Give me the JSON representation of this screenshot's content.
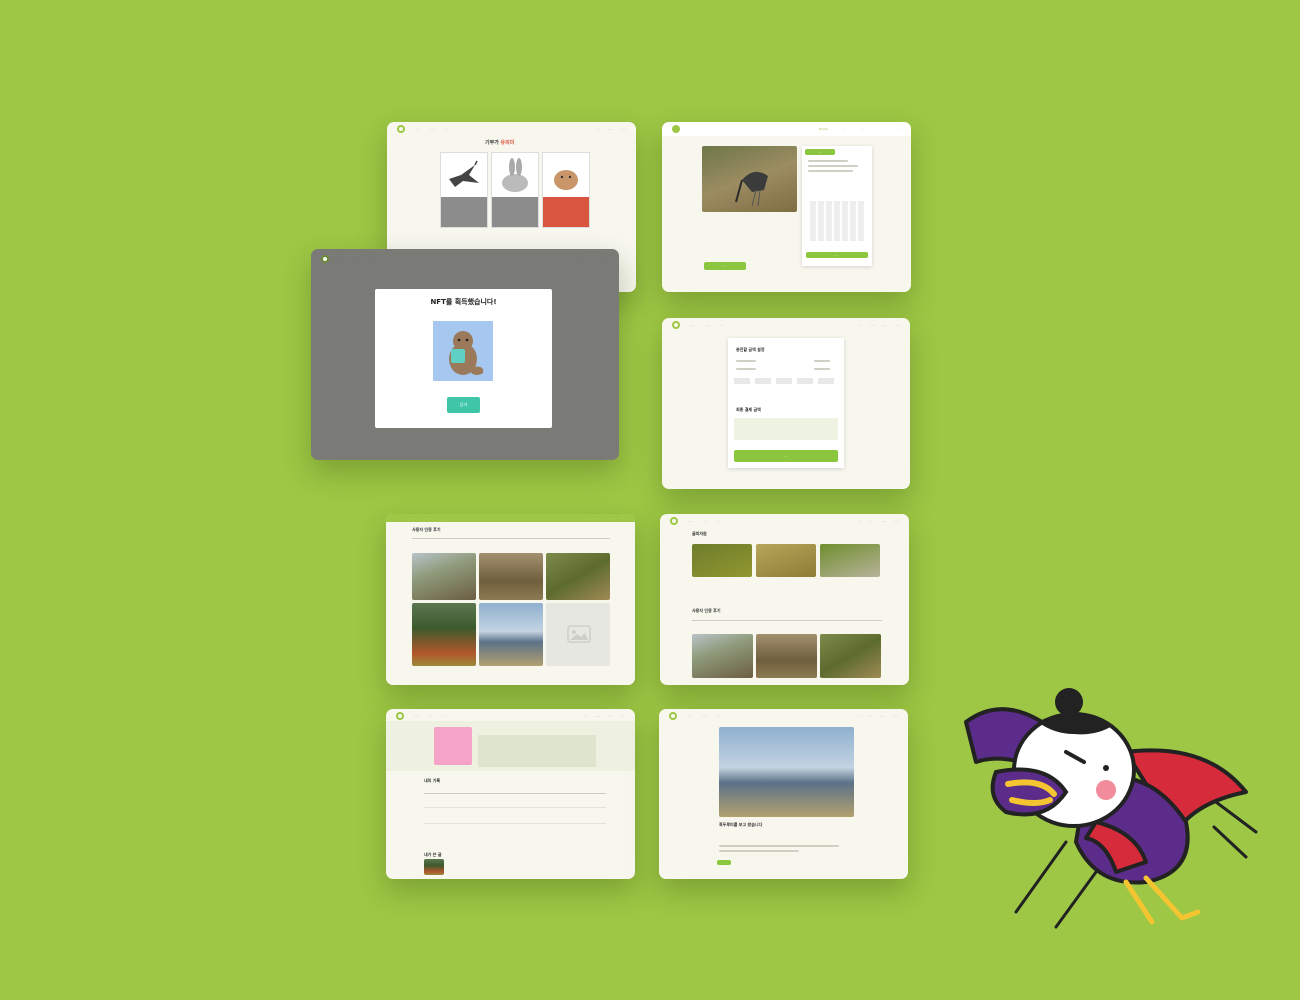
{
  "modal": {
    "title": "NFT를 획득했습니다!",
    "close_label": "닫기"
  },
  "donate": {
    "title_prefix": "기부가 ",
    "title_highlight": "유의미"
  },
  "amount": {
    "section1": "충전할 금액 설정",
    "section2": "최종 결제 금액"
  },
  "gallery": {
    "title": "사용자 인증 후기"
  },
  "home": {
    "section1": "굴피자원",
    "section2": "사용자 인증 후기"
  },
  "mypage": {
    "section1": "내의 기록",
    "section2": "내가 쓴 글"
  },
  "review": {
    "title": "흑두루미를 보고 왔습니다"
  },
  "colors": {
    "background": "#9dc744",
    "accent_green": "#8cc63f",
    "teal_button": "#3fc6a8",
    "accent_red": "#d9553f"
  },
  "icons": [
    "heart-logo-icon",
    "image-placeholder-icon",
    "otter-nft-icon"
  ]
}
